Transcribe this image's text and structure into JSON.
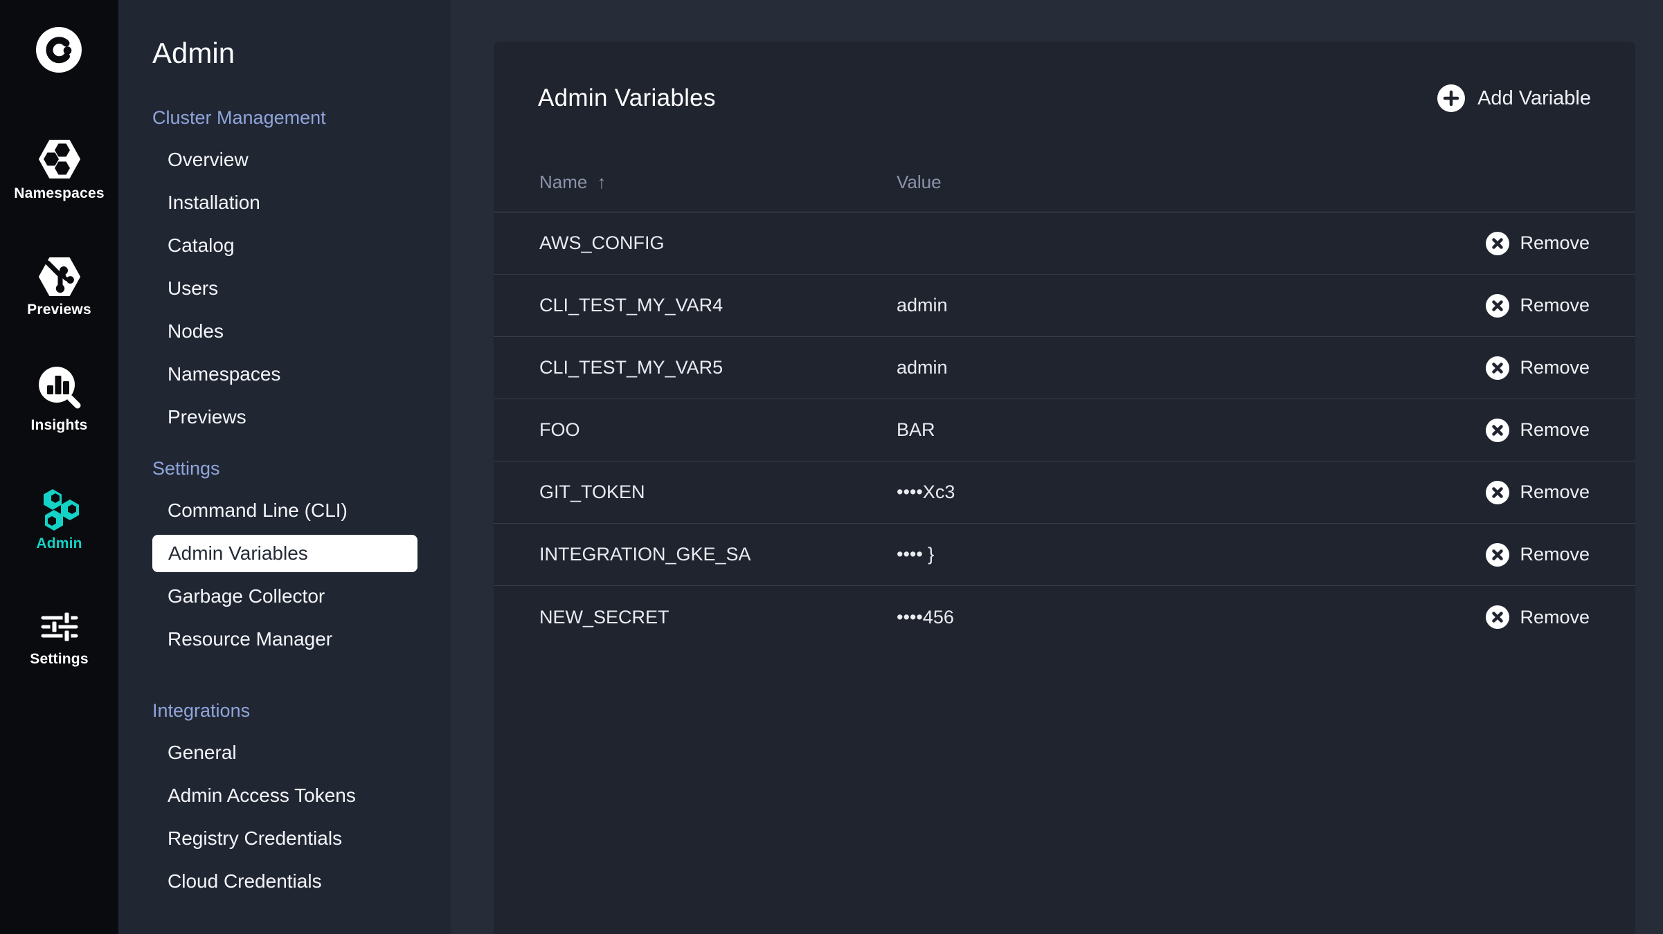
{
  "colors": {
    "accent_teal": "#14d2c5",
    "rail_bg": "#0a0b0f",
    "sidebar_bg": "#212633",
    "main_bg": "#272c39",
    "card_bg": "#20242f",
    "selected_item_bg": "#ffffff",
    "section_header_text": "#8fa5da",
    "table_header_text": "#8b93a8"
  },
  "rail": {
    "items": [
      {
        "label": "Namespaces"
      },
      {
        "label": "Previews"
      },
      {
        "label": "Insights"
      },
      {
        "label": "Admin",
        "active": true
      },
      {
        "label": "Settings"
      }
    ]
  },
  "sidebar": {
    "title": "Admin",
    "sections": [
      {
        "label": "Cluster Management",
        "items": [
          "Overview",
          "Installation",
          "Catalog",
          "Users",
          "Nodes",
          "Namespaces",
          "Previews"
        ]
      },
      {
        "label": "Settings",
        "items": [
          "Command Line (CLI)",
          "Admin Variables",
          "Garbage Collector",
          "Resource Manager"
        ],
        "selected": "Admin Variables"
      },
      {
        "label": "Integrations",
        "items": [
          "General",
          "Admin Access Tokens",
          "Registry Credentials",
          "Cloud Credentials"
        ]
      }
    ]
  },
  "main": {
    "card": {
      "title": "Admin Variables",
      "add_button_label": "Add Variable",
      "table": {
        "columns": [
          {
            "label": "Name",
            "sort_indicator": "↑"
          },
          {
            "label": "Value"
          }
        ],
        "remove_label": "Remove",
        "rows": [
          {
            "name": "AWS_CONFIG",
            "value": ""
          },
          {
            "name": "CLI_TEST_MY_VAR4",
            "value": "admin"
          },
          {
            "name": "CLI_TEST_MY_VAR5",
            "value": "admin"
          },
          {
            "name": "FOO",
            "value": "BAR"
          },
          {
            "name": "GIT_TOKEN",
            "value": "••••Xc3"
          },
          {
            "name": "INTEGRATION_GKE_SA",
            "value": "•••• }"
          },
          {
            "name": "NEW_SECRET",
            "value": "••••456"
          }
        ]
      }
    }
  }
}
